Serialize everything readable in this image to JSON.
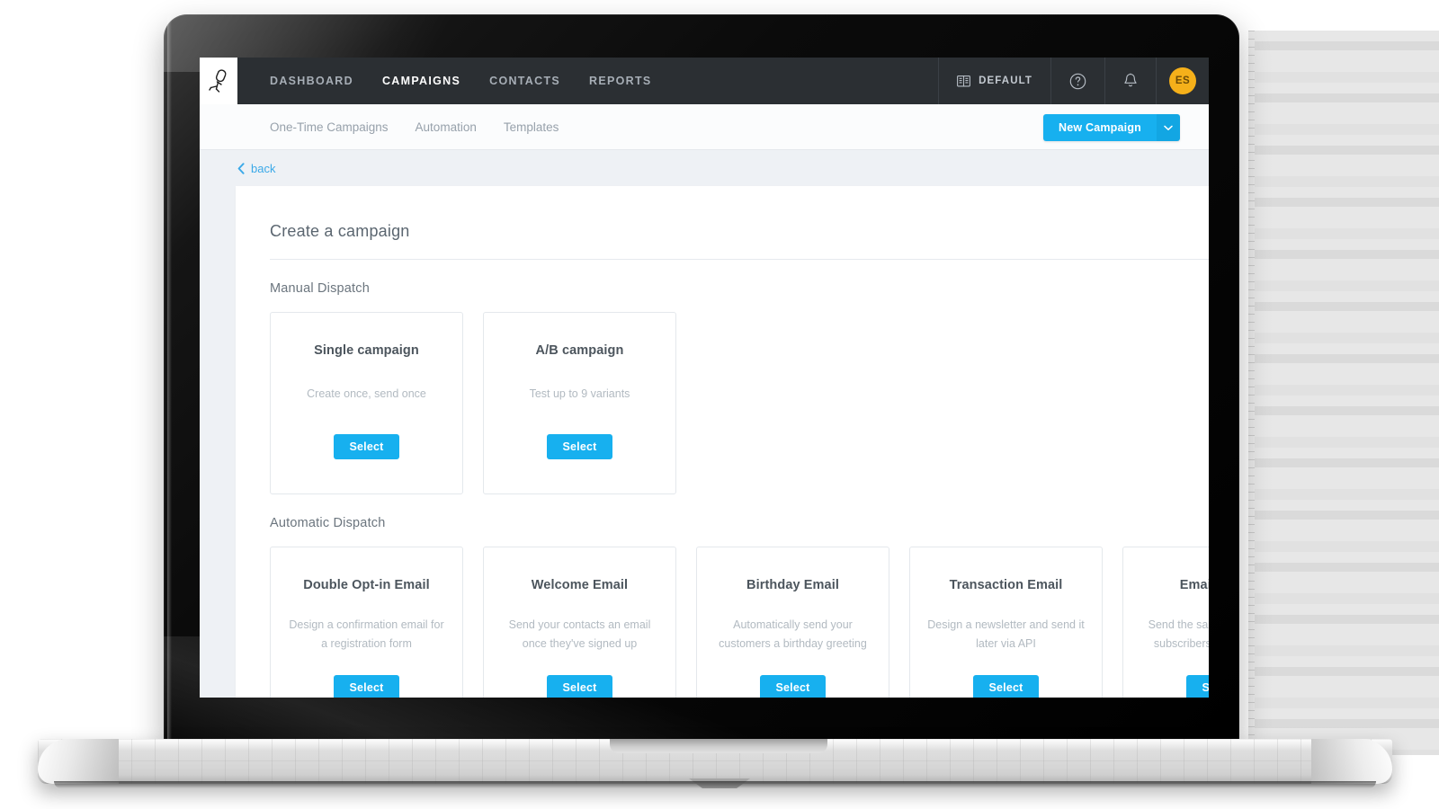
{
  "app": {
    "logo_icon": "running-figure-logo-icon",
    "topnav": [
      {
        "label": "DASHBOARD",
        "active": false
      },
      {
        "label": "CAMPAIGNS",
        "active": true
      },
      {
        "label": "CONTACTS",
        "active": false
      },
      {
        "label": "REPORTS",
        "active": false
      }
    ],
    "topnav_right": {
      "workspace_icon": "book-icon",
      "workspace_label": "DEFAULT",
      "help_icon": "question-circle-icon",
      "notifications_icon": "bell-icon",
      "avatar_initials": "ES"
    }
  },
  "subnav": {
    "tabs": [
      {
        "label": "One-Time Campaigns"
      },
      {
        "label": "Automation"
      },
      {
        "label": "Templates"
      }
    ],
    "new_campaign_label": "New Campaign",
    "new_campaign_caret_icon": "chevron-down-icon"
  },
  "backlink": {
    "icon": "chevron-left-icon",
    "label": "back"
  },
  "page": {
    "title": "Create a campaign",
    "sections": [
      {
        "label": "Manual Dispatch",
        "cards": [
          {
            "title": "Single campaign",
            "desc": "Create once, send once",
            "button": "Select"
          },
          {
            "title": "A/B campaign",
            "desc": "Test up to 9 variants",
            "button": "Select"
          }
        ]
      },
      {
        "label": "Automatic Dispatch",
        "cards": [
          {
            "title": "Double Opt-in Email",
            "desc": "Design a confirmation email for a registration form",
            "button": "Select"
          },
          {
            "title": "Welcome Email",
            "desc": "Send your contacts an email once they've signed up",
            "button": "Select"
          },
          {
            "title": "Birthday Email",
            "desc": "Automatically send your customers a birthday greeting",
            "button": "Select"
          },
          {
            "title": "Transaction Email",
            "desc": "Design a newsletter and send it later via API",
            "button": "Select"
          },
          {
            "title": "Email Series",
            "desc": "Send the same email to new subscribers on a schedule",
            "button": "Select"
          }
        ]
      }
    ]
  },
  "colors": {
    "accent_blue": "#17b0ef",
    "topbar_dark": "#2b2f33",
    "page_bg": "#eef1f5",
    "avatar_orange": "#f5b01a",
    "link_blue": "#3ba9e8"
  }
}
